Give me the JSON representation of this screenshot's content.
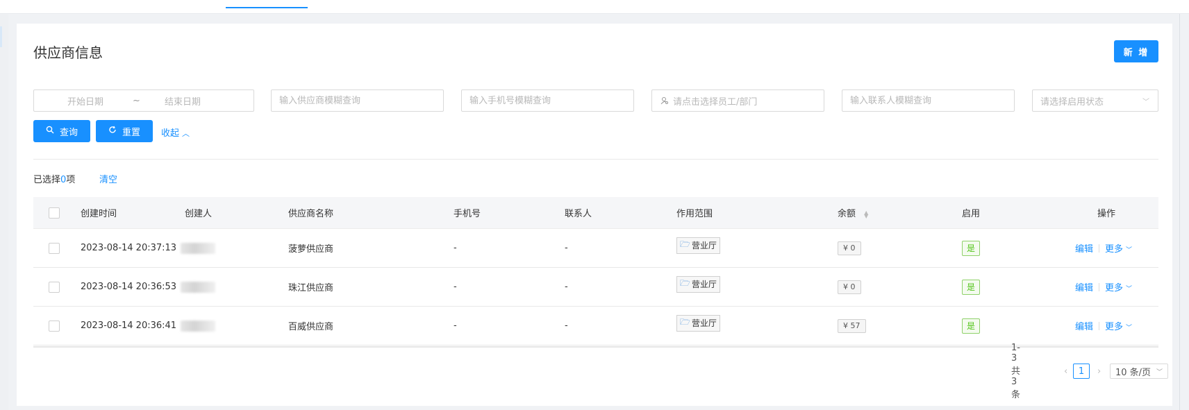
{
  "page": {
    "title": "供应商信息",
    "add_button": "新 增"
  },
  "filters": {
    "start_date_placeholder": "开始日期",
    "date_separator": "~",
    "end_date_placeholder": "结束日期",
    "supplier_placeholder": "输入供应商模糊查询",
    "phone_placeholder": "输入手机号模糊查询",
    "staff_placeholder": "请点击选择员工/部门",
    "contact_placeholder": "输入联系人模糊查询",
    "status_placeholder": "请选择启用状态",
    "query_button": "查询",
    "reset_button": "重置",
    "collapse_link": "收起"
  },
  "selection": {
    "prefix": "已选择",
    "count": "0",
    "suffix": "项",
    "clear_link": "清空"
  },
  "table": {
    "columns": {
      "created_time": "创建时间",
      "creator": "创建人",
      "supplier_name": "供应商名称",
      "phone": "手机号",
      "contact": "联系人",
      "scope": "作用范围",
      "balance": "余额",
      "enabled": "启用",
      "actions": "操作"
    },
    "rows": [
      {
        "created_time": "2023-08-14 20:37:13",
        "supplier_name": "菠萝供应商",
        "phone": "-",
        "contact": "-",
        "scope": "营业厅",
        "balance": "¥ 0",
        "enabled": "是",
        "edit": "编辑",
        "more": "更多"
      },
      {
        "created_time": "2023-08-14 20:36:53",
        "supplier_name": "珠江供应商",
        "phone": "-",
        "contact": "-",
        "scope": "营业厅",
        "balance": "¥ 0",
        "enabled": "是",
        "edit": "编辑",
        "more": "更多"
      },
      {
        "created_time": "2023-08-14 20:36:41",
        "supplier_name": "百威供应商",
        "phone": "-",
        "contact": "-",
        "scope": "营业厅",
        "balance": "¥ 57",
        "enabled": "是",
        "edit": "编辑",
        "more": "更多"
      }
    ]
  },
  "pagination": {
    "total_text": "1-3 共3条",
    "current_page": "1",
    "page_size": "10 条/页"
  },
  "colors": {
    "primary": "#1890ff",
    "success": "#52c41a"
  }
}
